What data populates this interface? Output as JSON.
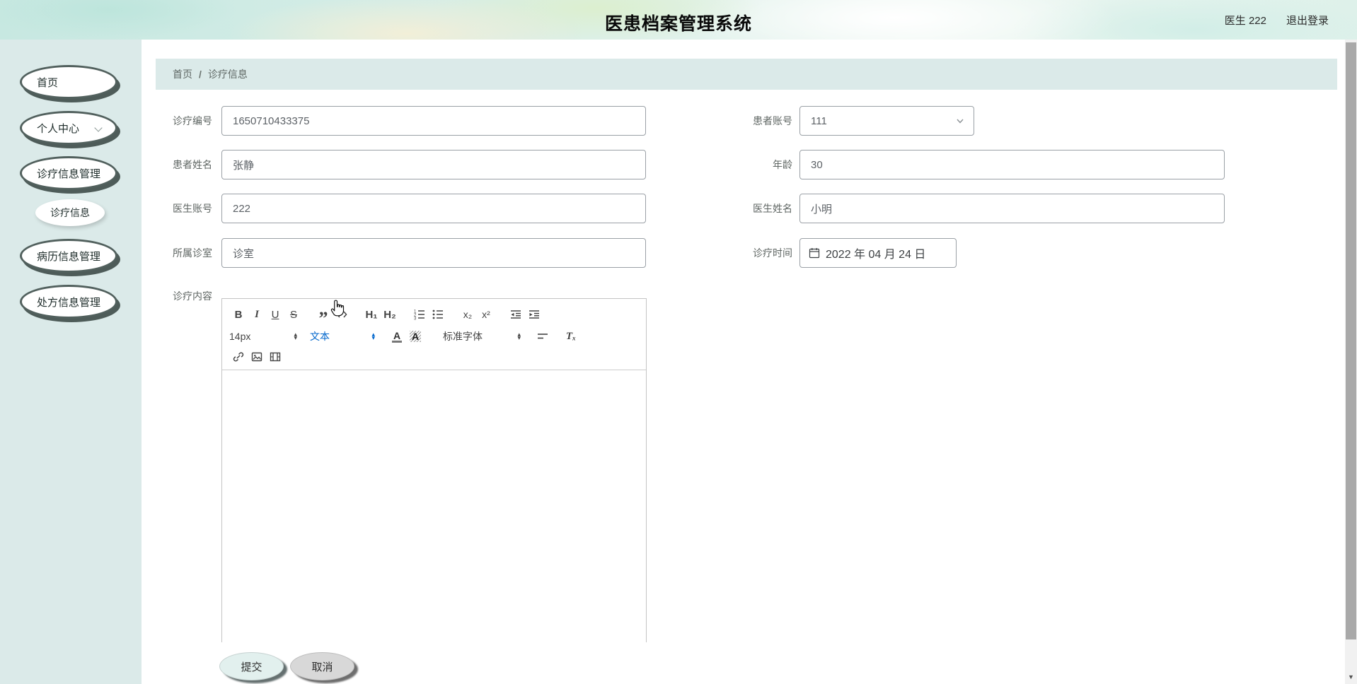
{
  "header": {
    "title": "医患档案管理系统",
    "user_label": "医生 222",
    "logout_label": "退出登录"
  },
  "sidebar": {
    "items": [
      {
        "label": "首页"
      },
      {
        "label": "个人中心",
        "has_dropdown": true
      },
      {
        "label": "诊疗信息管理"
      },
      {
        "label": "诊疗信息",
        "active": true
      },
      {
        "label": "病历信息管理"
      },
      {
        "label": "处方信息管理"
      }
    ]
  },
  "breadcrumb": {
    "home": "首页",
    "separator": "/",
    "current": "诊疗信息"
  },
  "form": {
    "treatment_no": {
      "label": "诊疗编号",
      "value": "1650710433375"
    },
    "patient_account": {
      "label": "患者账号",
      "value": "111"
    },
    "patient_name": {
      "label": "患者姓名",
      "value": "张静"
    },
    "age": {
      "label": "年龄",
      "value": "30"
    },
    "doctor_account": {
      "label": "医生账号",
      "value": "222"
    },
    "doctor_name": {
      "label": "医生姓名",
      "value": "小明"
    },
    "clinic": {
      "label": "所属诊室",
      "value": "诊室"
    },
    "treatment_time": {
      "label": "诊疗时间",
      "value": "2022 年 04 月 24 日"
    },
    "content_label": "诊疗内容",
    "submit_label": "提交",
    "cancel_label": "取消"
  },
  "editor": {
    "toolbar": {
      "bold": "B",
      "italic": "I",
      "underline": "U",
      "strike": "S",
      "blockquote": "”",
      "header1": "H₁",
      "header2": "H₂",
      "subscript": "x₂",
      "superscript": "x²",
      "size_value": "14px",
      "format_value": "文本",
      "color_letter": "A",
      "background_letter": "A",
      "font_value": "标准字体",
      "clean": "Tₓ"
    },
    "content": "",
    "icons": {
      "code_block": "code-brackets",
      "ordered_list": "numbered-list",
      "bullet_list": "bulleted-list",
      "outdent": "indent-minus",
      "indent": "indent-plus",
      "align": "align-left",
      "link": "chain-link",
      "image": "picture",
      "video": "film-frame"
    }
  },
  "colors": {
    "sidebar_bg": "#dbeae9",
    "breadcrumb_bg": "#dbeae9",
    "accent_blue": "#0066cc",
    "submit_bg": "#e2f0ee",
    "cancel_bg": "#d8d8d8",
    "oval_border": "#4e5c59"
  }
}
